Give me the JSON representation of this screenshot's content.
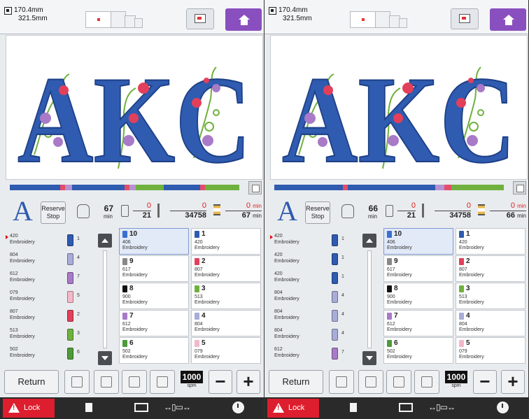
{
  "panels": [
    {
      "size": {
        "width": "170.4mm",
        "height": "321.5mm"
      },
      "status": {
        "font_letter": "A",
        "reserve_label_1": "Reserve",
        "reserve_label_2": "Stop",
        "time_remaining": "67",
        "time_unit": "min",
        "color_count": "0",
        "color_total": "21",
        "stitch_count": "0",
        "stitch_total": "34758",
        "time_count": "0",
        "time_count_unit": "min",
        "time_total": "67",
        "time_total_unit": "min"
      },
      "color_bar_progress": 0,
      "color_bar": [
        {
          "color": "#2f5bb0",
          "share": 0.22
        },
        {
          "color": "#e44d6a",
          "share": 0.02
        },
        {
          "color": "#b592d1",
          "share": 0.03
        },
        {
          "color": "#2f5bb0",
          "share": 0.23
        },
        {
          "color": "#e44d6a",
          "share": 0.02
        },
        {
          "color": "#b592d1",
          "share": 0.03
        },
        {
          "color": "#6fb13e",
          "share": 0.12
        },
        {
          "color": "#2f5bb0",
          "share": 0.16
        },
        {
          "color": "#e44d6a",
          "share": 0.02
        },
        {
          "color": "#6fb13e",
          "share": 0.15
        }
      ],
      "thread_list": [
        {
          "code": "420",
          "type": "Embroidery",
          "n": "1",
          "color": "#2f5bb0",
          "current": true
        },
        {
          "code": "804",
          "type": "Embroidery",
          "n": "4",
          "color": "#a8acd8",
          "current": false
        },
        {
          "code": "612",
          "type": "Embroidery",
          "n": "7",
          "color": "#a87ac8",
          "current": false
        },
        {
          "code": "079",
          "type": "Embroidery",
          "n": "5",
          "color": "#f4b8c8",
          "current": false
        },
        {
          "code": "807",
          "type": "Embroidery",
          "n": "2",
          "color": "#e2405a",
          "current": false
        },
        {
          "code": "513",
          "type": "Embroidery",
          "n": "3",
          "color": "#6fb13e",
          "current": false
        },
        {
          "code": "502",
          "type": "Embroidery",
          "n": "6",
          "color": "#4f9a3a",
          "current": false
        }
      ],
      "thread_grid": [
        {
          "n": "10",
          "code": "406",
          "type": "Embroidery",
          "color": "#3a6fd0",
          "selected": true
        },
        {
          "n": "1",
          "code": "420",
          "type": "Embroidery",
          "color": "#2f5bb0",
          "selected": false
        },
        {
          "n": "9",
          "code": "617",
          "type": "Embroidery",
          "color": "#888888",
          "selected": false
        },
        {
          "n": "2",
          "code": "807",
          "type": "Embroidery",
          "color": "#e2405a",
          "selected": false
        },
        {
          "n": "8",
          "code": "900",
          "type": "Embroidery",
          "color": "#111111",
          "selected": false
        },
        {
          "n": "3",
          "code": "513",
          "type": "Embroidery",
          "color": "#6fb13e",
          "selected": false
        },
        {
          "n": "7",
          "code": "612",
          "type": "Embroidery",
          "color": "#a87ac8",
          "selected": false
        },
        {
          "n": "4",
          "code": "804",
          "type": "Embroidery",
          "color": "#a8acd8",
          "selected": false
        },
        {
          "n": "6",
          "code": "502",
          "type": "Embroidery",
          "color": "#4f9a3a",
          "selected": false
        },
        {
          "n": "5",
          "code": "079",
          "type": "Embroidery",
          "color": "#f4b8c8",
          "selected": false
        }
      ],
      "bottom": {
        "return_label": "Return",
        "speed": "1000",
        "speed_unit": "spm",
        "minus": "−",
        "plus": "+"
      },
      "footer": {
        "lock_label": "Lock",
        "move_glyph": "↔▯▭↔"
      }
    },
    {
      "size": {
        "width": "170.4mm",
        "height": "321.5mm"
      },
      "status": {
        "font_letter": "A",
        "reserve_label_1": "Reserve",
        "reserve_label_2": "Stop",
        "time_remaining": "66",
        "time_unit": "min",
        "color_count": "0",
        "color_total": "21",
        "stitch_count": "0",
        "stitch_total": "34758",
        "time_count": "0",
        "time_count_unit": "min",
        "time_total": "66",
        "time_total_unit": "min"
      },
      "color_bar_progress": 0,
      "color_bar": [
        {
          "color": "#2f5bb0",
          "share": 0.3
        },
        {
          "color": "#e44d6a",
          "share": 0.02
        },
        {
          "color": "#2f5bb0",
          "share": 0.38
        },
        {
          "color": "#b592d1",
          "share": 0.04
        },
        {
          "color": "#e44d6a",
          "share": 0.03
        },
        {
          "color": "#6fb13e",
          "share": 0.23
        }
      ],
      "thread_list": [
        {
          "code": "420",
          "type": "Embroidery",
          "n": "1",
          "color": "#2f5bb0",
          "current": true
        },
        {
          "code": "420",
          "type": "Embroidery",
          "n": "1",
          "color": "#2f5bb0",
          "current": false
        },
        {
          "code": "420",
          "type": "Embroidery",
          "n": "1",
          "color": "#2f5bb0",
          "current": false
        },
        {
          "code": "804",
          "type": "Embroidery",
          "n": "4",
          "color": "#a8acd8",
          "current": false
        },
        {
          "code": "804",
          "type": "Embroidery",
          "n": "4",
          "color": "#a8acd8",
          "current": false
        },
        {
          "code": "804",
          "type": "Embroidery",
          "n": "4",
          "color": "#a8acd8",
          "current": false
        },
        {
          "code": "612",
          "type": "Embroidery",
          "n": "7",
          "color": "#a87ac8",
          "current": false
        }
      ],
      "thread_grid": [
        {
          "n": "10",
          "code": "406",
          "type": "Embroidery",
          "color": "#3a6fd0",
          "selected": true
        },
        {
          "n": "1",
          "code": "420",
          "type": "Embroidery",
          "color": "#2f5bb0",
          "selected": false
        },
        {
          "n": "9",
          "code": "617",
          "type": "Embroidery",
          "color": "#888888",
          "selected": false
        },
        {
          "n": "2",
          "code": "807",
          "type": "Embroidery",
          "color": "#e2405a",
          "selected": false
        },
        {
          "n": "8",
          "code": "900",
          "type": "Embroidery",
          "color": "#111111",
          "selected": false
        },
        {
          "n": "3",
          "code": "513",
          "type": "Embroidery",
          "color": "#6fb13e",
          "selected": false
        },
        {
          "n": "7",
          "code": "612",
          "type": "Embroidery",
          "color": "#a87ac8",
          "selected": false
        },
        {
          "n": "4",
          "code": "804",
          "type": "Embroidery",
          "color": "#a8acd8",
          "selected": false
        },
        {
          "n": "6",
          "code": "502",
          "type": "Embroidery",
          "color": "#4f9a3a",
          "selected": false
        },
        {
          "n": "5",
          "code": "079",
          "type": "Embroidery",
          "color": "#f4b8c8",
          "selected": false
        }
      ],
      "bottom": {
        "return_label": "Return",
        "speed": "1000",
        "speed_unit": "spm",
        "minus": "−",
        "plus": "+"
      },
      "footer": {
        "lock_label": "Lock",
        "move_glyph": "↔▯▭↔"
      }
    }
  ],
  "design": {
    "monogram": "AKC",
    "letter_color": "#2f5bb0"
  }
}
